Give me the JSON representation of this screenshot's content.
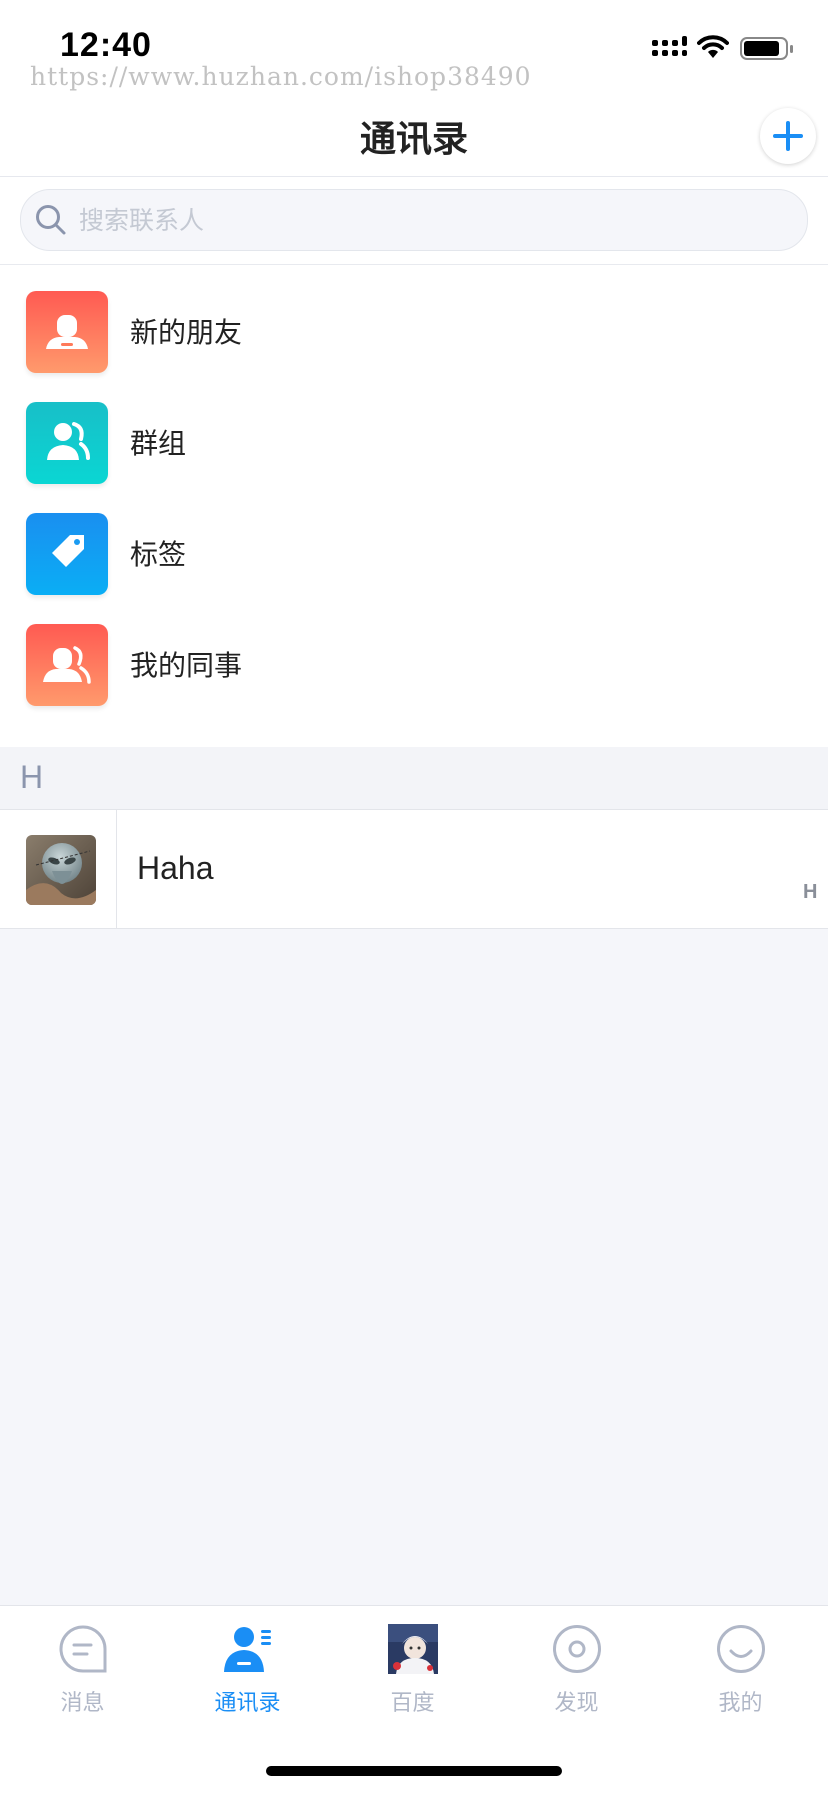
{
  "status_bar": {
    "time": "12:40",
    "watermark": "https://www.huzhan.com/ishop38490"
  },
  "nav": {
    "title": "通讯录"
  },
  "search": {
    "placeholder": "搜索联系人"
  },
  "menu": [
    {
      "label": "新的朋友",
      "icon": "new-friend-icon"
    },
    {
      "label": "群组",
      "icon": "group-icon"
    },
    {
      "label": "标签",
      "icon": "tag-icon"
    },
    {
      "label": "我的同事",
      "icon": "colleagues-icon"
    }
  ],
  "contacts": {
    "section_letter": "H",
    "items": [
      {
        "name": "Haha"
      }
    ],
    "index": [
      "H"
    ]
  },
  "tabs": [
    {
      "label": "消息",
      "icon": "message-icon",
      "active": false
    },
    {
      "label": "通讯录",
      "icon": "contacts-icon",
      "active": true
    },
    {
      "label": "百度",
      "icon": "baidu-avatar-icon",
      "active": false
    },
    {
      "label": "发现",
      "icon": "discover-icon",
      "active": false
    },
    {
      "label": "我的",
      "icon": "profile-icon",
      "active": false
    }
  ],
  "colors": {
    "accent": "#1a8ef5",
    "inactive": "#b0b7c7",
    "background": "#f5f6fa"
  }
}
